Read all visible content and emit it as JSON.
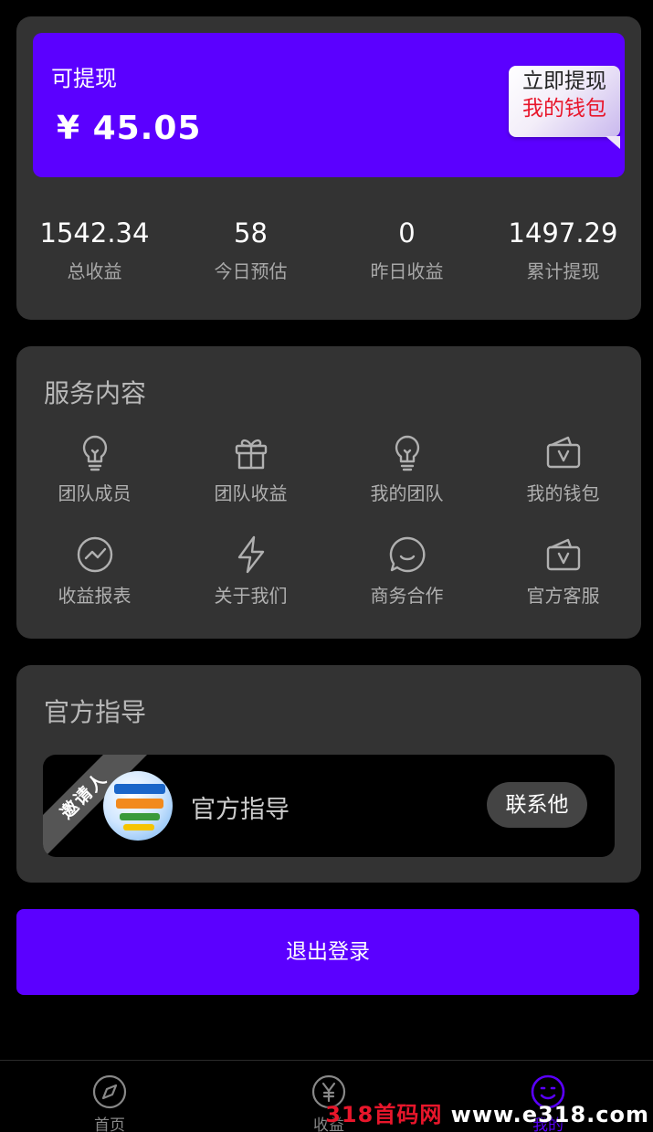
{
  "wallet": {
    "withdrawable_label": "可提现",
    "balance": "¥ 45.05",
    "withdraw_button": {
      "line1": "立即提现",
      "line2": "我的钱包"
    },
    "stats": [
      {
        "value": "1542.34",
        "label": "总收益"
      },
      {
        "value": "58",
        "label": "今日预估"
      },
      {
        "value": "0",
        "label": "昨日收益"
      },
      {
        "value": "1497.29",
        "label": "累计提现"
      }
    ]
  },
  "services": {
    "title": "服务内容",
    "items": [
      {
        "label": "团队成员",
        "icon": "lightbulb-icon"
      },
      {
        "label": "团队收益",
        "icon": "gift-icon"
      },
      {
        "label": "我的团队",
        "icon": "lightbulb-icon"
      },
      {
        "label": "我的钱包",
        "icon": "wallet-icon"
      },
      {
        "label": "收益报表",
        "icon": "chart-circle-icon"
      },
      {
        "label": "关于我们",
        "icon": "lightning-icon"
      },
      {
        "label": "商务合作",
        "icon": "chat-icon"
      },
      {
        "label": "官方客服",
        "icon": "wallet-icon"
      }
    ]
  },
  "guide": {
    "title": "官方指导",
    "ribbon": "邀请人",
    "name": "官方指导",
    "contact_button": "联系他"
  },
  "logout_button": "退出登录",
  "nav": {
    "items": [
      {
        "label": "首页",
        "icon": "compass-icon"
      },
      {
        "label": "收益",
        "icon": "yen-circle-icon"
      },
      {
        "label": "我的",
        "icon": "smile-icon"
      }
    ],
    "active_color": "#5b00ff"
  },
  "watermark": {
    "part1": "318首码网",
    "part2": " www.e318.com"
  },
  "colors": {
    "accent": "#5b00ff",
    "card": "#333333",
    "background": "#000000",
    "highlight_red": "#e8162b"
  }
}
